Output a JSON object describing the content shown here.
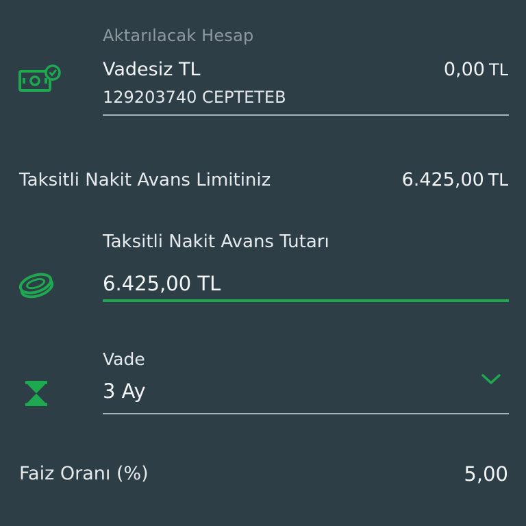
{
  "transfer_account": {
    "label": "Aktarılacak Hesap",
    "name": "Vadesiz TL",
    "balance": "0,00",
    "currency": "TL",
    "number": "129203740 CEPTETEB",
    "icon": "money-check-icon"
  },
  "limit": {
    "label": "Taksitli Nakit Avans Limitiniz",
    "value": "6.425,00",
    "currency": "TL"
  },
  "amount": {
    "label": "Taksitli Nakit Avans Tutarı",
    "value": "6.425,00 TL",
    "icon": "coin-icon"
  },
  "term": {
    "label": "Vade",
    "value": "3 Ay",
    "icon": "hourglass-icon"
  },
  "rate": {
    "label": "Faiz Oranı (%)",
    "value": "5,00"
  },
  "colors": {
    "background": "#2d3e46",
    "accent": "#1ea84f",
    "divider": "#a9b4b8",
    "muted_text": "#8d9aa0"
  }
}
